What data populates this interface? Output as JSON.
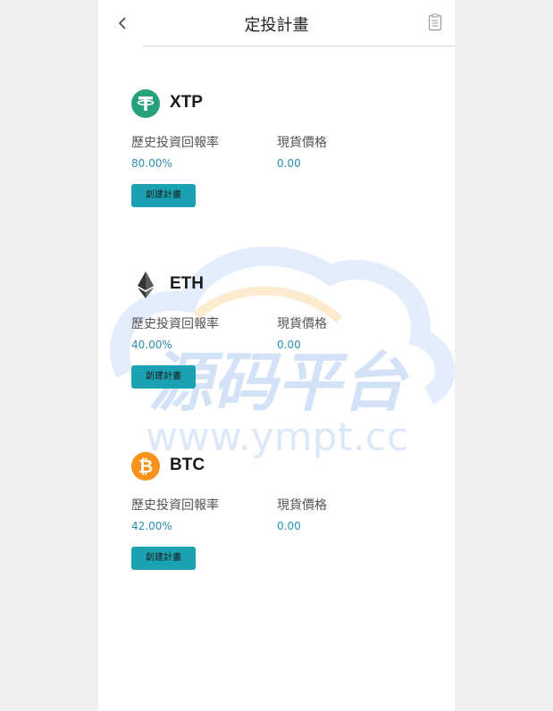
{
  "header": {
    "back_icon": "chevron-left-icon",
    "title": "定投計畫",
    "doc_icon": "document-icon"
  },
  "coins": [
    {
      "name": "XTP",
      "icon": "tether-icon",
      "icon_color": "#26a17b",
      "return_label": "歷史投資回報率",
      "price_label": "現貨價格",
      "return_value": "80.00%",
      "price_value": "0.00",
      "button_label": "創建計畫"
    },
    {
      "name": "ETH",
      "icon": "ethereum-icon",
      "icon_color": "#343434",
      "return_label": "歷史投資回報率",
      "price_label": "現貨價格",
      "return_value": "40.00%",
      "price_value": "0.00",
      "button_label": "創建計畫"
    },
    {
      "name": "BTC",
      "icon": "bitcoin-icon",
      "icon_color": "#f7931a",
      "return_label": "歷史投資回報率",
      "price_label": "現貨價格",
      "return_value": "42.00%",
      "price_value": "0.00",
      "button_label": "創建計畫"
    }
  ],
  "watermark": {
    "title": "源码平台",
    "url": "www.ympt.cc"
  },
  "colors": {
    "accent": "#1aa2b3",
    "value_text": "#2d8fb0",
    "watermark_blue": "#3a7de0",
    "watermark_orange": "#f5a623"
  }
}
